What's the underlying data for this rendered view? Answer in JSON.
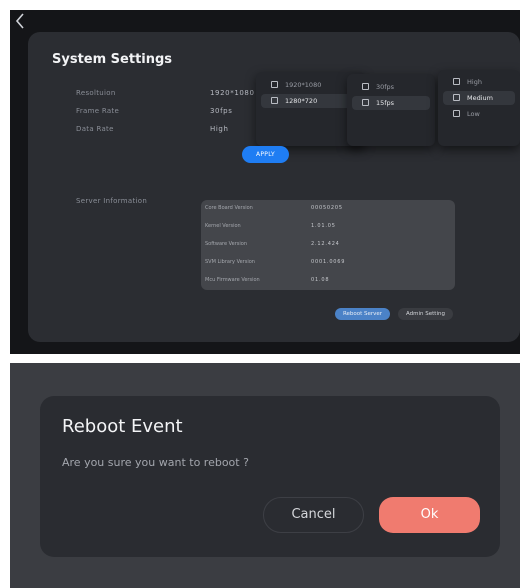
{
  "settings": {
    "back_icon": "chevron-left-icon",
    "title": "System Settings",
    "fields": [
      {
        "label": "Resoltuion",
        "value": "1920*1080"
      },
      {
        "label": "Frame Rate",
        "value": "30fps"
      },
      {
        "label": "Data Rate",
        "value": "High"
      }
    ],
    "resolution_options": [
      {
        "label": "1920*1080",
        "selected": false
      },
      {
        "label": "1280*720",
        "selected": true
      }
    ],
    "framerate_options": [
      {
        "label": "30fps",
        "selected": false
      },
      {
        "label": "15fps",
        "selected": true
      }
    ],
    "datarate_options": [
      {
        "label": "High",
        "selected": false
      },
      {
        "label": "Medium",
        "selected": true
      },
      {
        "label": "Low",
        "selected": false
      }
    ],
    "apply_label": "APPLY",
    "server_info_label": "Server Information",
    "server_info": [
      {
        "key": "Core Board Version",
        "value": "00050205"
      },
      {
        "key": "Kernel Version",
        "value": "1.01.05"
      },
      {
        "key": "Software Version",
        "value": "2.12.424"
      },
      {
        "key": "SVM Library Version",
        "value": "0001.0069"
      },
      {
        "key": "Mcu Firmware Version",
        "value": "01.08"
      }
    ],
    "reboot_label": "Reboot Server",
    "admin_label": "Admin Setting",
    "accent_color": "#1f7df3"
  },
  "dialog": {
    "title": "Reboot Event",
    "message": "Are you sure you want to reboot ?",
    "cancel_label": "Cancel",
    "ok_label": "Ok",
    "ok_color": "#f07b6f"
  }
}
